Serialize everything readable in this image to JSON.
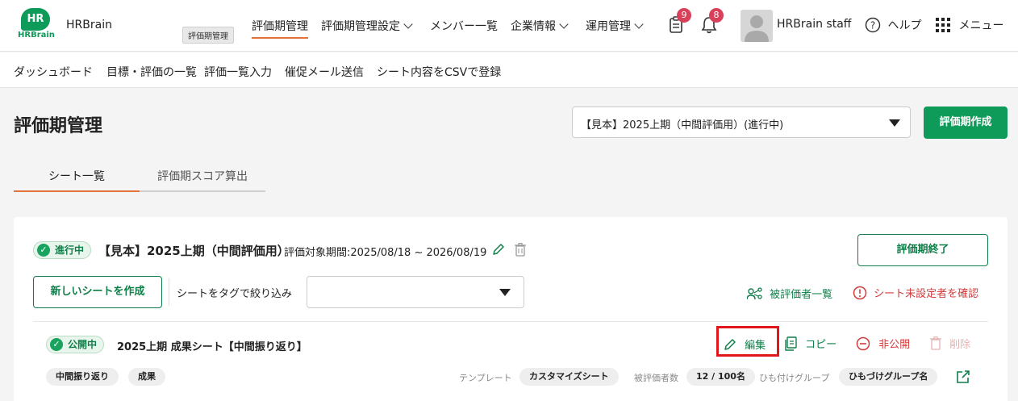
{
  "header": {
    "logo_text": "HR",
    "logo_sub": "HRBrain",
    "brand": "HRBrain",
    "tooltip": "評価期管理",
    "nav": [
      {
        "label": "評価期管理",
        "active": true
      },
      {
        "label": "評価期管理設定",
        "dropdown": true
      },
      {
        "label": "メンバー一覧"
      },
      {
        "label": "企業情報",
        "dropdown": true
      },
      {
        "label": "運用管理",
        "dropdown": true
      }
    ],
    "notifications": {
      "clipboard_count": "9",
      "bell_count": "8"
    },
    "user_name": "HRBrain staff",
    "help_label": "ヘルプ",
    "menu_label": "メニュー"
  },
  "subnav": [
    "ダッシュボード",
    "目標・評価の一覧",
    "評価一覧入力",
    "催促メール送信",
    "シート内容をCSVで登録"
  ],
  "page": {
    "title": "評価期管理",
    "period_select": "【見本】2025上期（中間評価用）(進行中)",
    "create_button": "評価期作成"
  },
  "tabs": [
    {
      "label": "シート一覧",
      "active": true
    },
    {
      "label": "評価期スコア算出",
      "active": false
    }
  ],
  "period_card": {
    "status": "進行中",
    "title": "【見本】2025上期（中間評価用）",
    "period_text": "評価対象期間:2025/08/18 ~ 2026/08/19",
    "end_button": "評価期終了",
    "new_sheet_button": "新しいシートを作成",
    "tag_filter_label": "シートをタグで絞り込み",
    "tag_filter_value": "",
    "evaluatee_list": "被評価者一覧",
    "unset_check": "シート未設定者を確認"
  },
  "sheet": {
    "status": "公開中",
    "title": "2025上期 成果シート【中間振り返り】",
    "actions": {
      "edit": "編集",
      "copy": "コピー",
      "unpublish": "非公開",
      "delete": "削除"
    },
    "tags": [
      "中間振り返り",
      "成果"
    ],
    "template_label": "テンプレート",
    "template_value": "カスタマイズシート",
    "evaluatee_count_label": "被評価者数",
    "evaluatee_count_value": "12 / 100名",
    "linked_group_label": "ひも付けグループ",
    "linked_group_value": "ひもづけグループ名"
  },
  "colors": {
    "brand_green": "#0e9b5a",
    "accent_orange": "#e2733c",
    "danger_red": "#d23c3c",
    "highlight_red": "#e0161b"
  }
}
